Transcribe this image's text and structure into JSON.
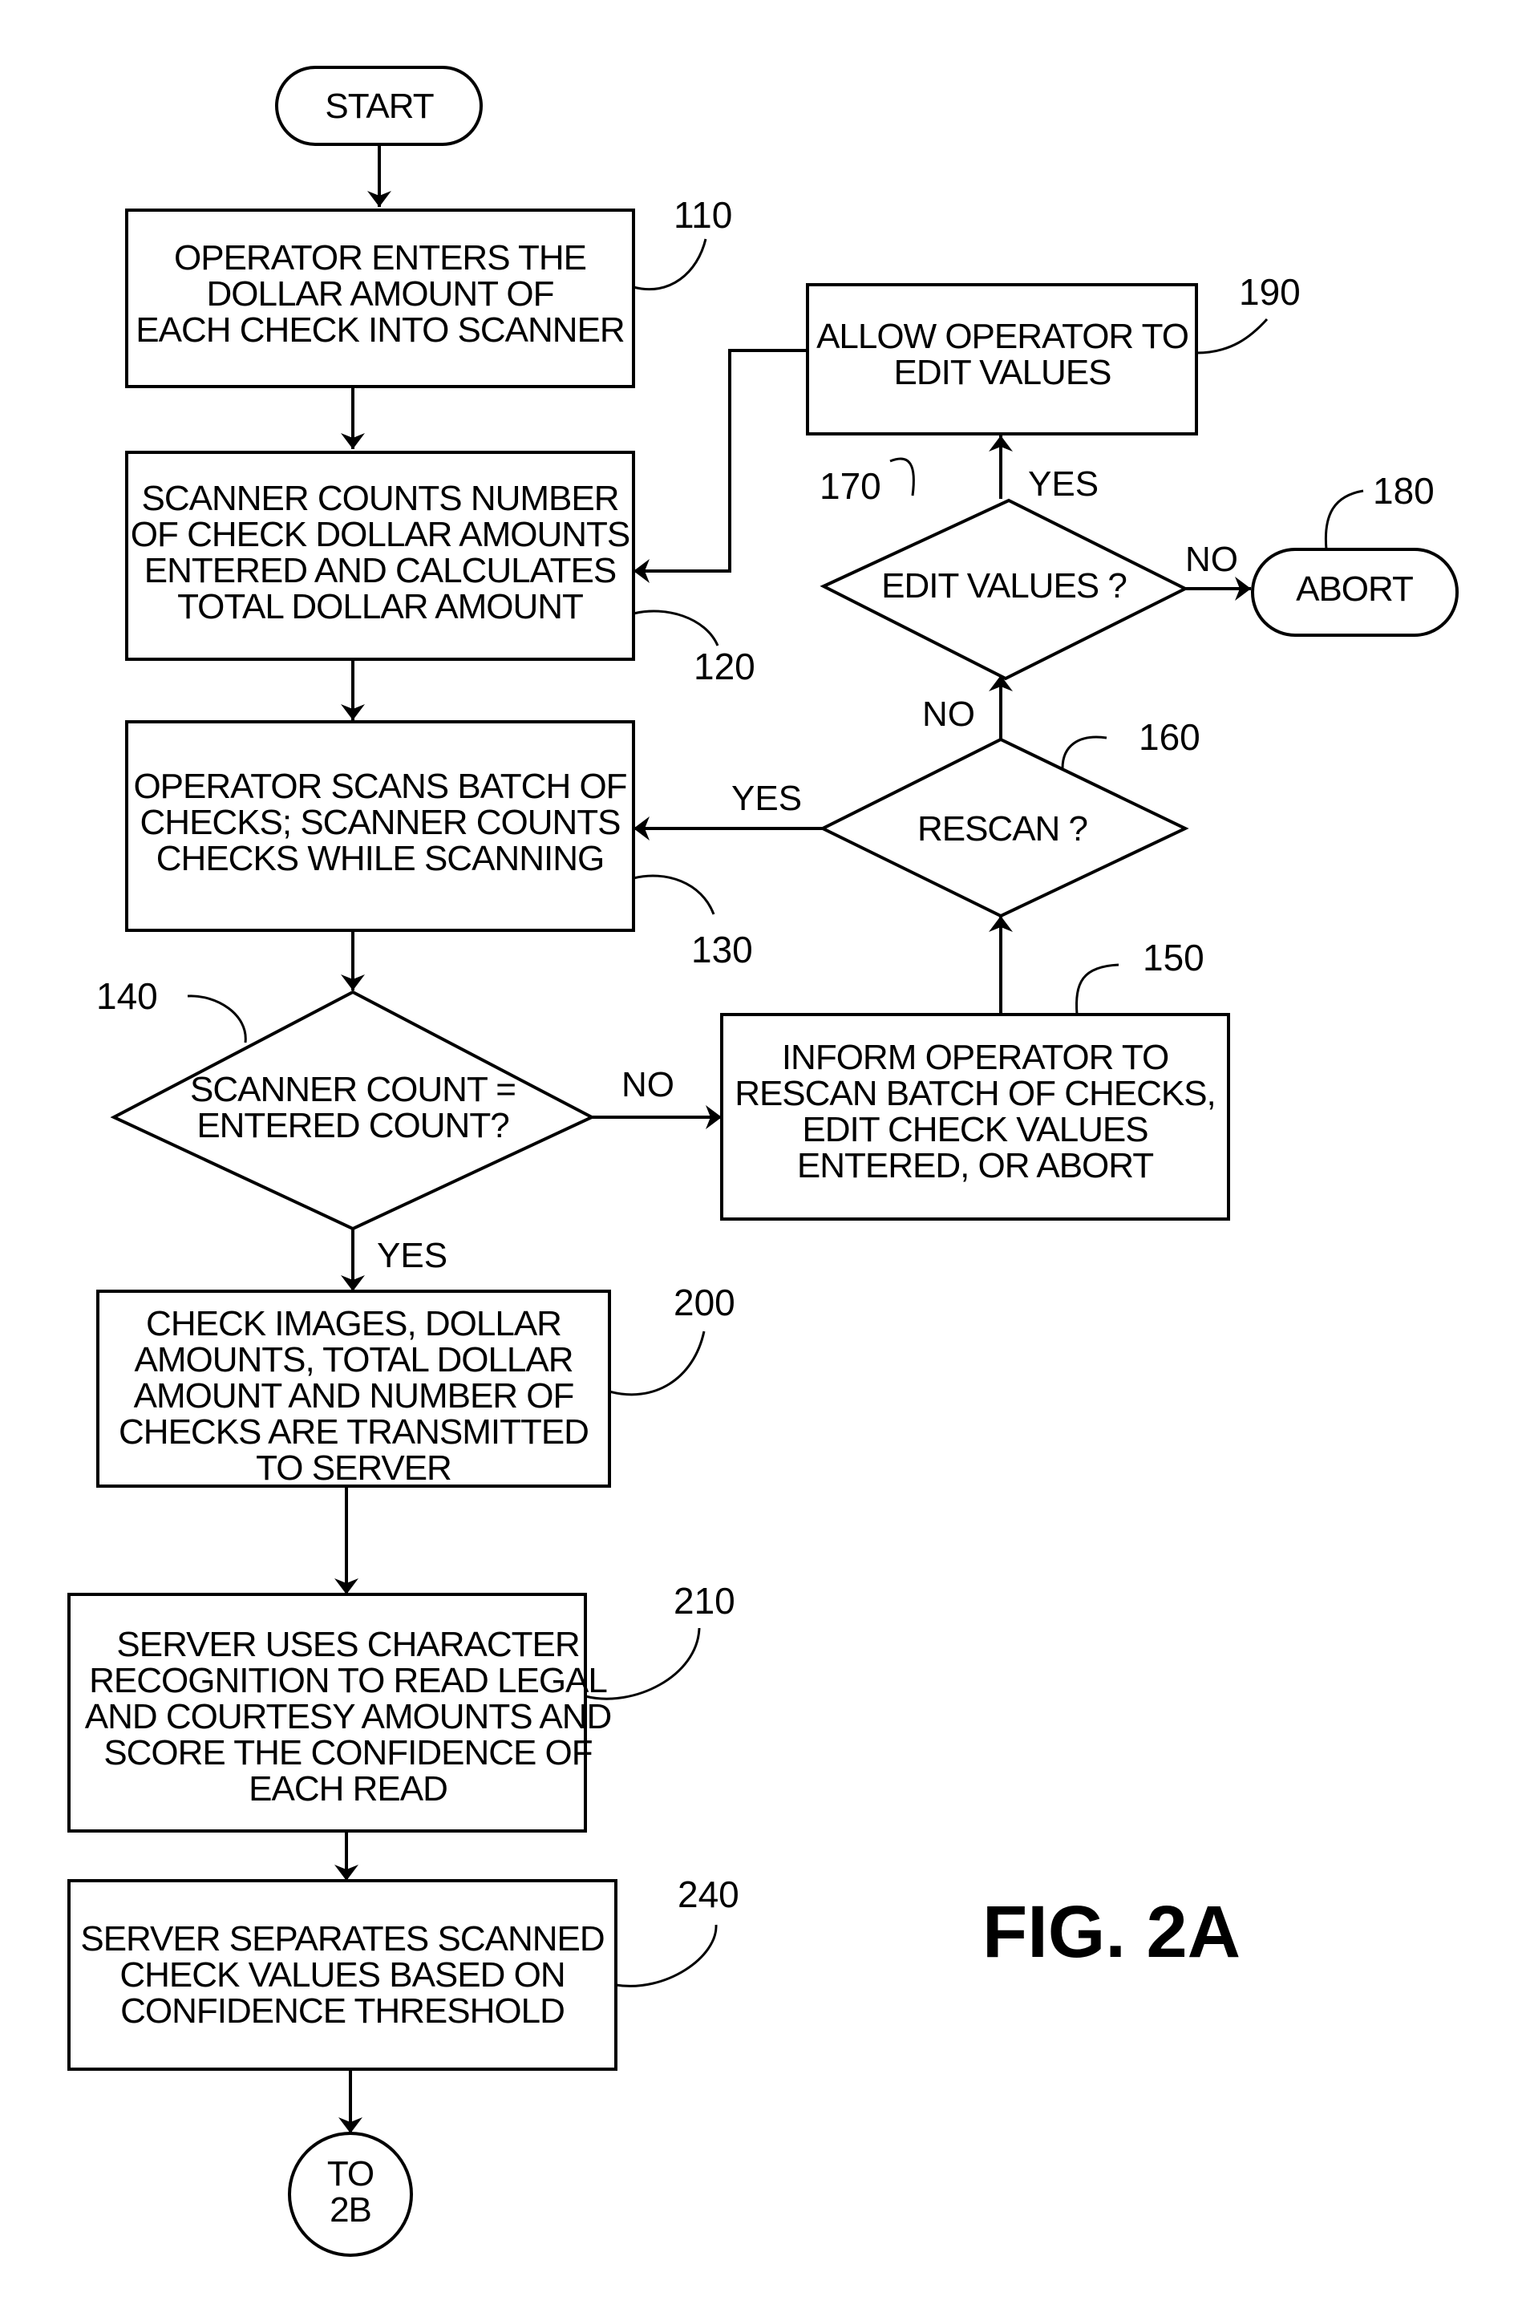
{
  "figure": {
    "label": "FIG. 2A"
  },
  "nodes": {
    "start": {
      "type": "terminal",
      "lines": [
        "START"
      ]
    },
    "n110": {
      "type": "process",
      "ref": "110",
      "lines": [
        "OPERATOR ENTERS THE",
        "DOLLAR AMOUNT OF",
        "EACH CHECK INTO SCANNER"
      ]
    },
    "n120": {
      "type": "process",
      "ref": "120",
      "lines": [
        "SCANNER COUNTS NUMBER",
        "OF CHECK DOLLAR AMOUNTS",
        "ENTERED AND CALCULATES",
        "TOTAL DOLLAR AMOUNT"
      ]
    },
    "n130": {
      "type": "process",
      "ref": "130",
      "lines": [
        "OPERATOR SCANS BATCH OF",
        "CHECKS; SCANNER COUNTS",
        "CHECKS WHILE SCANNING"
      ]
    },
    "n140": {
      "type": "decision",
      "ref": "140",
      "lines": [
        "SCANNER COUNT =",
        "ENTERED COUNT?"
      ]
    },
    "n150": {
      "type": "process",
      "ref": "150",
      "lines": [
        "INFORM OPERATOR TO",
        "RESCAN BATCH OF CHECKS,",
        "EDIT CHECK VALUES",
        "ENTERED, OR ABORT"
      ]
    },
    "n160": {
      "type": "decision",
      "ref": "160",
      "lines": [
        "RESCAN ?"
      ]
    },
    "n170": {
      "type": "decision",
      "ref": "170",
      "lines": [
        "EDIT VALUES ?"
      ]
    },
    "n180": {
      "type": "terminal",
      "ref": "180",
      "lines": [
        "ABORT"
      ]
    },
    "n190": {
      "type": "process",
      "ref": "190",
      "lines": [
        "ALLOW OPERATOR TO",
        "EDIT VALUES"
      ]
    },
    "n200": {
      "type": "process",
      "ref": "200",
      "lines": [
        "CHECK IMAGES, DOLLAR",
        "AMOUNTS, TOTAL DOLLAR",
        "AMOUNT AND NUMBER OF",
        "CHECKS ARE TRANSMITTED",
        "TO SERVER"
      ]
    },
    "n210": {
      "type": "process",
      "ref": "210",
      "lines": [
        "SERVER USES CHARACTER",
        "RECOGNITION TO READ LEGAL",
        "AND COURTESY AMOUNTS AND",
        "SCORE THE CONFIDENCE OF",
        "EACH READ"
      ]
    },
    "n240": {
      "type": "process",
      "ref": "240",
      "lines": [
        "SERVER SEPARATES SCANNED",
        "CHECK VALUES BASED ON",
        "CONFIDENCE THRESHOLD"
      ]
    },
    "connector": {
      "type": "connector",
      "lines": [
        "TO",
        "2B"
      ]
    }
  },
  "edges": [
    {
      "from": "start",
      "to": "n110",
      "label": ""
    },
    {
      "from": "n110",
      "to": "n120",
      "label": ""
    },
    {
      "from": "n120",
      "to": "n130",
      "label": ""
    },
    {
      "from": "n130",
      "to": "n140",
      "label": ""
    },
    {
      "from": "n140",
      "to": "n150",
      "label": "NO"
    },
    {
      "from": "n140",
      "to": "n200",
      "label": "YES"
    },
    {
      "from": "n150",
      "to": "n160",
      "label": ""
    },
    {
      "from": "n160",
      "to": "n130",
      "label": "YES"
    },
    {
      "from": "n160",
      "to": "n170",
      "label": "NO"
    },
    {
      "from": "n170",
      "to": "n190",
      "label": "YES"
    },
    {
      "from": "n170",
      "to": "n180",
      "label": "NO"
    },
    {
      "from": "n190",
      "to": "n120",
      "label": ""
    },
    {
      "from": "n200",
      "to": "n210",
      "label": ""
    },
    {
      "from": "n210",
      "to": "n240",
      "label": ""
    },
    {
      "from": "n240",
      "to": "connector",
      "label": ""
    }
  ]
}
